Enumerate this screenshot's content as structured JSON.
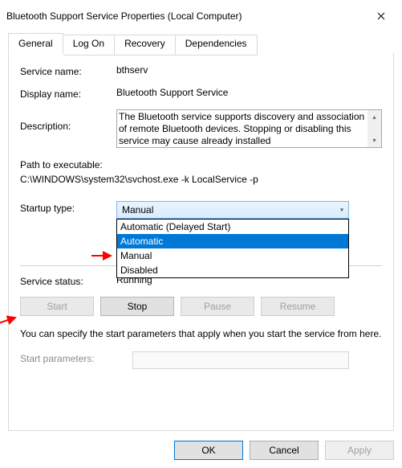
{
  "title": "Bluetooth Support Service Properties (Local Computer)",
  "tabs": {
    "general": "General",
    "logon": "Log On",
    "recovery": "Recovery",
    "deps": "Dependencies"
  },
  "labels": {
    "service_name": "Service name:",
    "display_name": "Display name:",
    "description": "Description:",
    "path": "Path to executable:",
    "startup_type": "Startup type:",
    "service_status": "Service status:",
    "start_params": "Start parameters:"
  },
  "values": {
    "service_name": "bthserv",
    "display_name": "Bluetooth Support Service",
    "description": "The Bluetooth service supports discovery and association of remote Bluetooth devices.  Stopping or disabling this service may cause already installed",
    "path": "C:\\WINDOWS\\system32\\svchost.exe -k LocalService -p",
    "startup_selected": "Manual",
    "status": "Running"
  },
  "startup_options": {
    "delayed": "Automatic (Delayed Start)",
    "auto": "Automatic",
    "manual": "Manual",
    "disabled": "Disabled"
  },
  "buttons": {
    "start": "Start",
    "stop": "Stop",
    "pause": "Pause",
    "resume": "Resume",
    "ok": "OK",
    "cancel": "Cancel",
    "apply": "Apply"
  },
  "hint": "You can specify the start parameters that apply when you start the service from here."
}
